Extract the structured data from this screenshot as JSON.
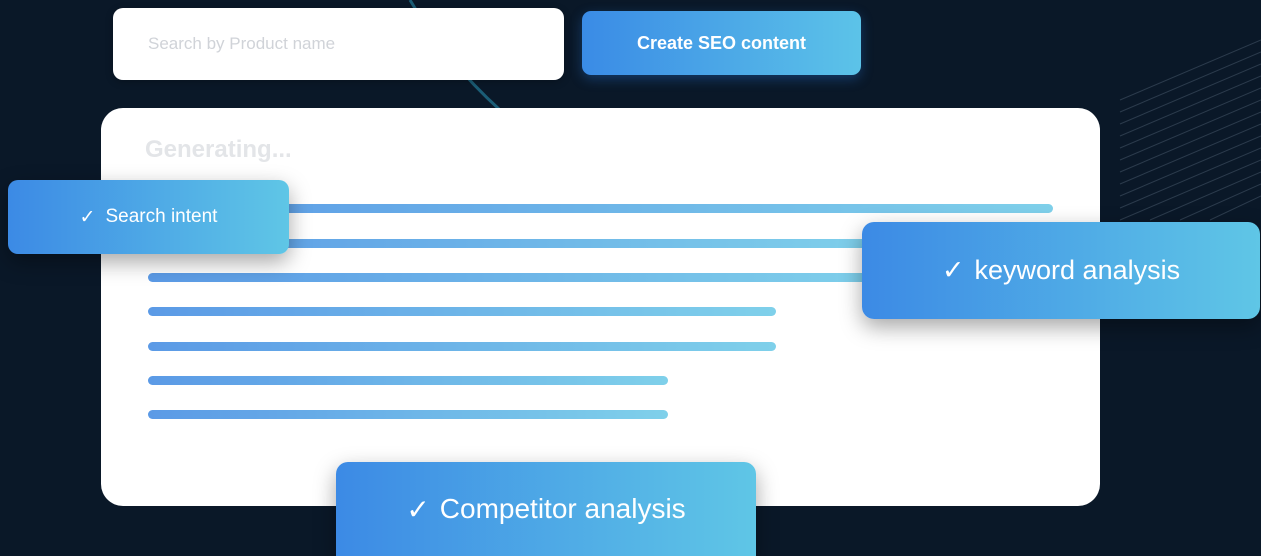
{
  "search": {
    "placeholder": "Search by Product name"
  },
  "toolbar": {
    "create_label": "Create SEO content"
  },
  "card": {
    "title": "Generating..."
  },
  "badges": {
    "check_icon": "✓",
    "search_intent": "Search intent",
    "keyword_analysis": "keyword analysis",
    "competitor_analysis": "Competitor analysis"
  },
  "colors": {
    "background": "#0a1828",
    "accent_start": "#3a8be6",
    "accent_end": "#5cc3e8"
  }
}
